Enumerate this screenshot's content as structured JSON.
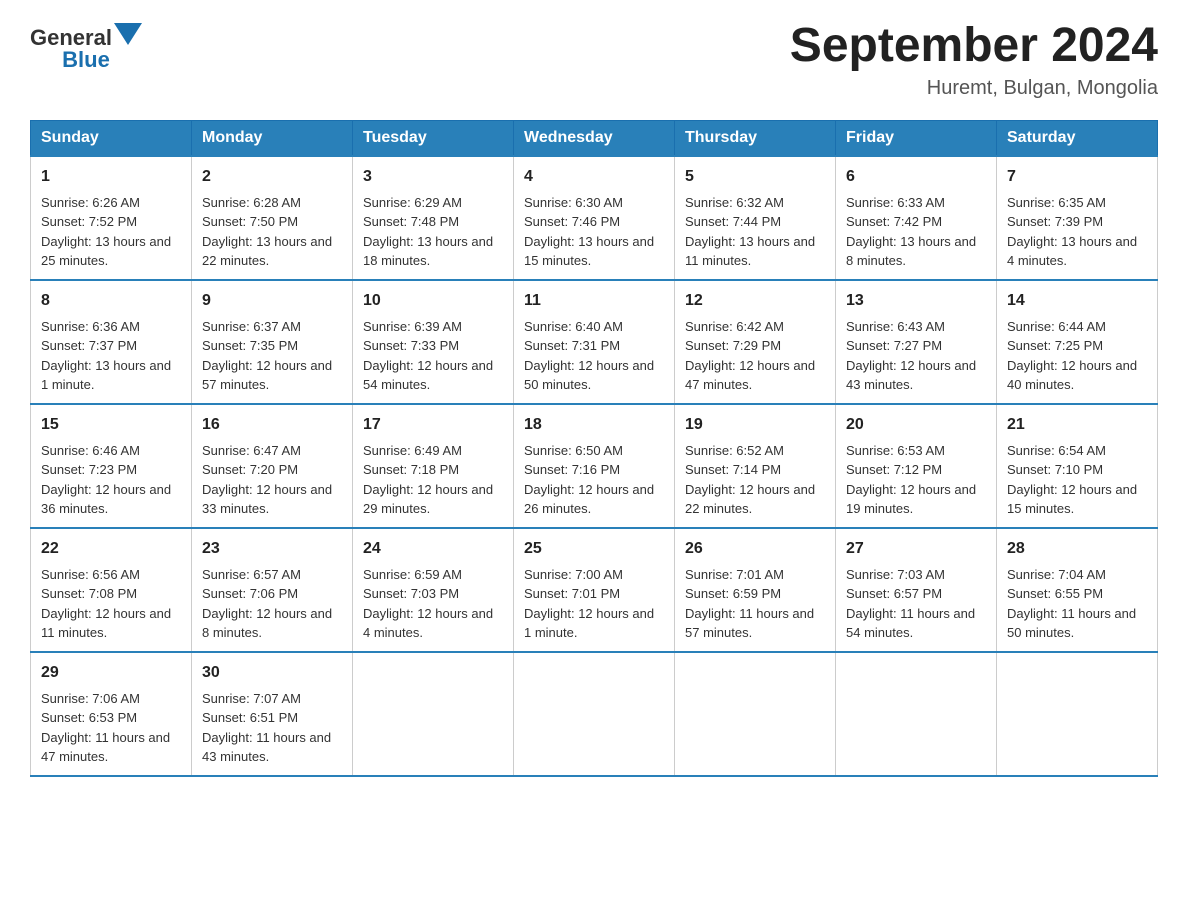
{
  "header": {
    "title": "September 2024",
    "subtitle": "Huremt, Bulgan, Mongolia"
  },
  "logo": {
    "text_general": "General",
    "text_blue": "Blue"
  },
  "days_of_week": [
    "Sunday",
    "Monday",
    "Tuesday",
    "Wednesday",
    "Thursday",
    "Friday",
    "Saturday"
  ],
  "weeks": [
    [
      {
        "date": "1",
        "sunrise": "6:26 AM",
        "sunset": "7:52 PM",
        "daylight": "13 hours and 25 minutes."
      },
      {
        "date": "2",
        "sunrise": "6:28 AM",
        "sunset": "7:50 PM",
        "daylight": "13 hours and 22 minutes."
      },
      {
        "date": "3",
        "sunrise": "6:29 AM",
        "sunset": "7:48 PM",
        "daylight": "13 hours and 18 minutes."
      },
      {
        "date": "4",
        "sunrise": "6:30 AM",
        "sunset": "7:46 PM",
        "daylight": "13 hours and 15 minutes."
      },
      {
        "date": "5",
        "sunrise": "6:32 AM",
        "sunset": "7:44 PM",
        "daylight": "13 hours and 11 minutes."
      },
      {
        "date": "6",
        "sunrise": "6:33 AM",
        "sunset": "7:42 PM",
        "daylight": "13 hours and 8 minutes."
      },
      {
        "date": "7",
        "sunrise": "6:35 AM",
        "sunset": "7:39 PM",
        "daylight": "13 hours and 4 minutes."
      }
    ],
    [
      {
        "date": "8",
        "sunrise": "6:36 AM",
        "sunset": "7:37 PM",
        "daylight": "13 hours and 1 minute."
      },
      {
        "date": "9",
        "sunrise": "6:37 AM",
        "sunset": "7:35 PM",
        "daylight": "12 hours and 57 minutes."
      },
      {
        "date": "10",
        "sunrise": "6:39 AM",
        "sunset": "7:33 PM",
        "daylight": "12 hours and 54 minutes."
      },
      {
        "date": "11",
        "sunrise": "6:40 AM",
        "sunset": "7:31 PM",
        "daylight": "12 hours and 50 minutes."
      },
      {
        "date": "12",
        "sunrise": "6:42 AM",
        "sunset": "7:29 PM",
        "daylight": "12 hours and 47 minutes."
      },
      {
        "date": "13",
        "sunrise": "6:43 AM",
        "sunset": "7:27 PM",
        "daylight": "12 hours and 43 minutes."
      },
      {
        "date": "14",
        "sunrise": "6:44 AM",
        "sunset": "7:25 PM",
        "daylight": "12 hours and 40 minutes."
      }
    ],
    [
      {
        "date": "15",
        "sunrise": "6:46 AM",
        "sunset": "7:23 PM",
        "daylight": "12 hours and 36 minutes."
      },
      {
        "date": "16",
        "sunrise": "6:47 AM",
        "sunset": "7:20 PM",
        "daylight": "12 hours and 33 minutes."
      },
      {
        "date": "17",
        "sunrise": "6:49 AM",
        "sunset": "7:18 PM",
        "daylight": "12 hours and 29 minutes."
      },
      {
        "date": "18",
        "sunrise": "6:50 AM",
        "sunset": "7:16 PM",
        "daylight": "12 hours and 26 minutes."
      },
      {
        "date": "19",
        "sunrise": "6:52 AM",
        "sunset": "7:14 PM",
        "daylight": "12 hours and 22 minutes."
      },
      {
        "date": "20",
        "sunrise": "6:53 AM",
        "sunset": "7:12 PM",
        "daylight": "12 hours and 19 minutes."
      },
      {
        "date": "21",
        "sunrise": "6:54 AM",
        "sunset": "7:10 PM",
        "daylight": "12 hours and 15 minutes."
      }
    ],
    [
      {
        "date": "22",
        "sunrise": "6:56 AM",
        "sunset": "7:08 PM",
        "daylight": "12 hours and 11 minutes."
      },
      {
        "date": "23",
        "sunrise": "6:57 AM",
        "sunset": "7:06 PM",
        "daylight": "12 hours and 8 minutes."
      },
      {
        "date": "24",
        "sunrise": "6:59 AM",
        "sunset": "7:03 PM",
        "daylight": "12 hours and 4 minutes."
      },
      {
        "date": "25",
        "sunrise": "7:00 AM",
        "sunset": "7:01 PM",
        "daylight": "12 hours and 1 minute."
      },
      {
        "date": "26",
        "sunrise": "7:01 AM",
        "sunset": "6:59 PM",
        "daylight": "11 hours and 57 minutes."
      },
      {
        "date": "27",
        "sunrise": "7:03 AM",
        "sunset": "6:57 PM",
        "daylight": "11 hours and 54 minutes."
      },
      {
        "date": "28",
        "sunrise": "7:04 AM",
        "sunset": "6:55 PM",
        "daylight": "11 hours and 50 minutes."
      }
    ],
    [
      {
        "date": "29",
        "sunrise": "7:06 AM",
        "sunset": "6:53 PM",
        "daylight": "11 hours and 47 minutes."
      },
      {
        "date": "30",
        "sunrise": "7:07 AM",
        "sunset": "6:51 PM",
        "daylight": "11 hours and 43 minutes."
      },
      null,
      null,
      null,
      null,
      null
    ]
  ]
}
